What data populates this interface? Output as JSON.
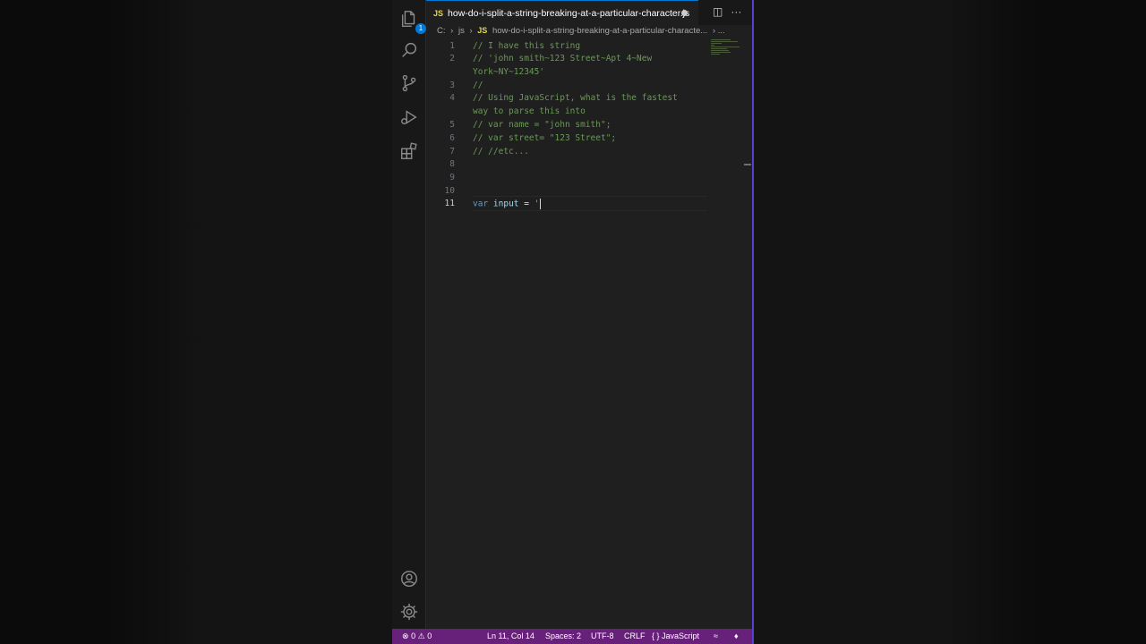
{
  "tab": {
    "file_badge": "JS",
    "title": "how-do-i-split-a-string-breaking-at-a-particular-character.js"
  },
  "breadcrumb": {
    "drive": "C:",
    "sep1": "›",
    "folder": "js",
    "sep2": "›",
    "file_badge": "JS",
    "file": "how-do-i-split-a-string-breaking-at-a-particular-characte...",
    "more": "›  ..."
  },
  "activity_bar": {
    "explorer_badge": "1"
  },
  "editor": {
    "lines": [
      {
        "num": "1",
        "text": "// I have this string"
      },
      {
        "num": "2",
        "text": "// 'john smith~123 Street~Apt 4~New"
      },
      {
        "num": "",
        "text": "York~NY~12345'"
      },
      {
        "num": "3",
        "text": "//"
      },
      {
        "num": "4",
        "text": "// Using JavaScript, what is the fastest"
      },
      {
        "num": "",
        "text": "way to parse this into"
      },
      {
        "num": "5",
        "text": "// var name = \"john smith\";"
      },
      {
        "num": "6",
        "text": "// var street= \"123 Street\";"
      },
      {
        "num": "7",
        "text": "// //etc..."
      },
      {
        "num": "8",
        "text": ""
      },
      {
        "num": "9",
        "text": ""
      },
      {
        "num": "10",
        "text": ""
      }
    ],
    "active_line": {
      "num": "11",
      "keyword": "var",
      "identifier": "input",
      "operator": "=",
      "string": "'"
    }
  },
  "status_bar": {
    "errors": "0",
    "warnings": "0",
    "position": "Ln 11, Col 14",
    "spaces": "Spaces: 2",
    "encoding": "UTF-8",
    "eol": "CRLF",
    "language_icon": "{ }",
    "language": "JavaScript"
  },
  "colors": {
    "accent": "#0078d4",
    "status_bar": "#68217a",
    "comment": "#6a9955",
    "keyword": "#569cd6"
  }
}
